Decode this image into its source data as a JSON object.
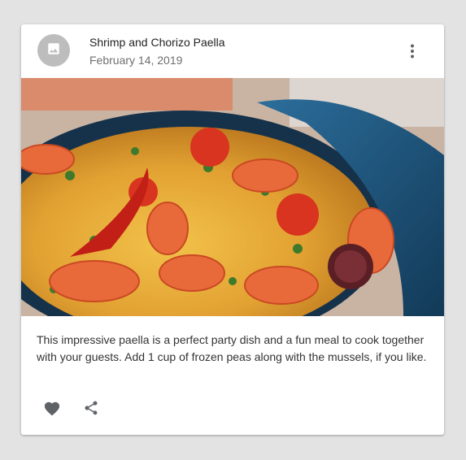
{
  "card": {
    "title": "Shrimp and Chorizo Paella",
    "subheader": "February 14, 2019",
    "body": "This impressive paella is a perfect party dish and a fun meal to cook together with your guests. Add 1 cup of frozen peas along with the mussels, if you like."
  },
  "icons": {
    "avatar": "image-icon",
    "menu": "more-vert-icon",
    "like": "favorite-icon",
    "share": "share-icon"
  },
  "colors": {
    "background": "#e3e3e3",
    "avatar": "#bdbdbd",
    "icon": "#5f6368"
  }
}
